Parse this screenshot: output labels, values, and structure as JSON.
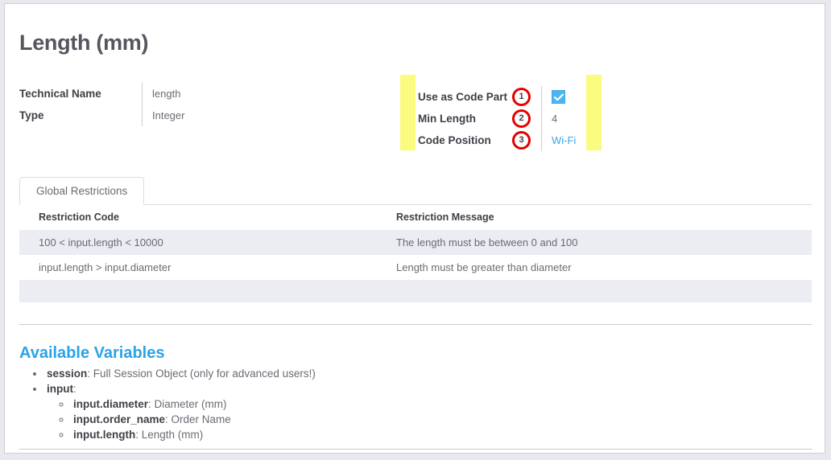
{
  "page": {
    "title": "Length (mm)"
  },
  "details_left": [
    {
      "label": "Technical Name",
      "value": "length"
    },
    {
      "label": "Type",
      "value": "Integer"
    }
  ],
  "details_right": [
    {
      "label": "Use as Code Part",
      "badge": "1",
      "value": "",
      "type": "checkbox",
      "checked": true
    },
    {
      "label": "Min Length",
      "badge": "2",
      "value": "4",
      "type": "text"
    },
    {
      "label": "Code Position",
      "badge": "3",
      "value": "Wi-Fi",
      "type": "link"
    }
  ],
  "tabs": [
    {
      "label": "Global Restrictions",
      "active": true
    }
  ],
  "table": {
    "columns": [
      "Restriction Code",
      "Restriction Message"
    ],
    "rows": [
      [
        "100 < input.length < 10000",
        "The length must be between 0 and 100"
      ],
      [
        "input.length > input.diameter",
        "Length must be greater than diameter"
      ],
      [
        "",
        ""
      ]
    ]
  },
  "available_variables": {
    "title": "Available Variables",
    "items": [
      {
        "key": "session",
        "desc": ": Full Session Object (only for advanced users!)"
      },
      {
        "key": "input",
        "desc": ":"
      }
    ],
    "sub_items": [
      {
        "key": "input.diameter",
        "desc": ": Diameter (mm)"
      },
      {
        "key": "input.order_name",
        "desc": ": Order Name"
      },
      {
        "key": "input.length",
        "desc": ": Length (mm)"
      }
    ]
  },
  "colors": {
    "accent_blue": "#2aa3e8",
    "checkbox_blue": "#4db5f0",
    "badge_red": "#e60000",
    "highlight_yellow": "#fbfb80",
    "stripe": "#ececf3"
  }
}
